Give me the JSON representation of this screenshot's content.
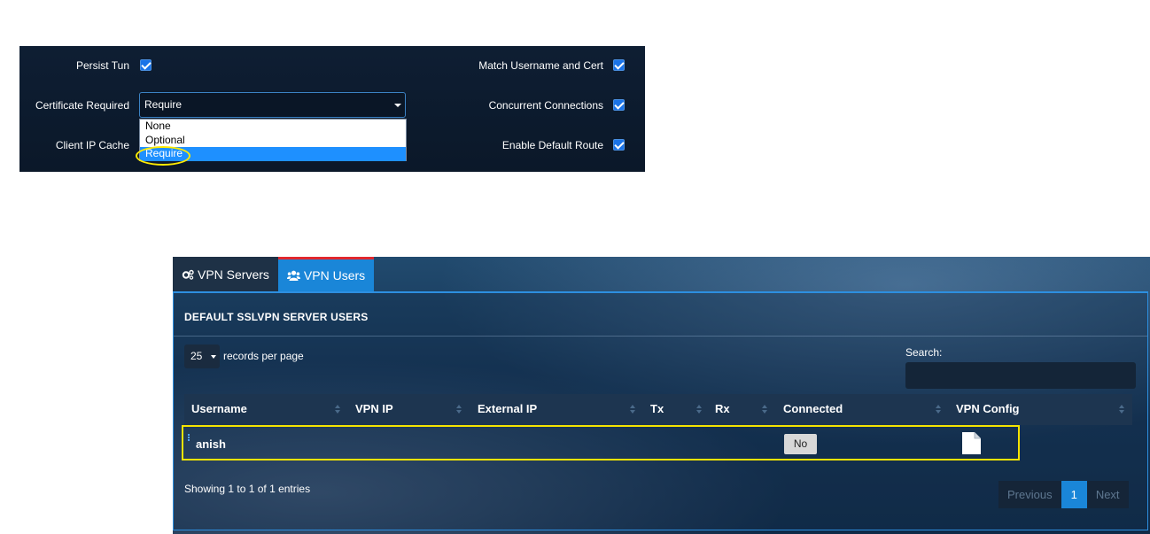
{
  "settings": {
    "persist_tun": {
      "label": "Persist Tun",
      "checked": true
    },
    "match_username_cert": {
      "label": "Match Username and Cert",
      "checked": true
    },
    "certificate_required": {
      "label": "Certificate Required",
      "value": "Require",
      "options": [
        "None",
        "Optional",
        "Require"
      ],
      "selected_option": "Require"
    },
    "concurrent_connections": {
      "label": "Concurrent Connections",
      "checked": true
    },
    "client_ip_cache": {
      "label": "Client IP Cache"
    },
    "enable_default_route": {
      "label": "Enable Default Route",
      "checked": true
    }
  },
  "vpn": {
    "tabs": [
      {
        "label": "VPN Servers",
        "icon": "gears-icon",
        "active": false
      },
      {
        "label": "VPN Users",
        "icon": "users-icon",
        "active": true
      }
    ],
    "section_title": "DEFAULT SSLVPN SERVER USERS",
    "records_per_page": {
      "value": "25",
      "label": "records per page"
    },
    "search": {
      "label": "Search:",
      "value": ""
    },
    "table": {
      "columns": [
        "Username",
        "VPN IP",
        "External IP",
        "Tx",
        "Rx",
        "Connected",
        "VPN Config"
      ],
      "rows": [
        {
          "username": "anish",
          "vpn_ip": "",
          "external_ip": "",
          "tx": "",
          "rx": "",
          "connected": "No",
          "vpn_config_icon": "file-icon"
        }
      ]
    },
    "info": "Showing 1 to 1 of 1 entries",
    "pagination": {
      "previous": "Previous",
      "current": "1",
      "next": "Next"
    }
  },
  "colors": {
    "accent": "#1a86d8",
    "highlight": "#f5e400",
    "tab_marker": "#e0282e",
    "checkbox": "#1a73e8"
  }
}
